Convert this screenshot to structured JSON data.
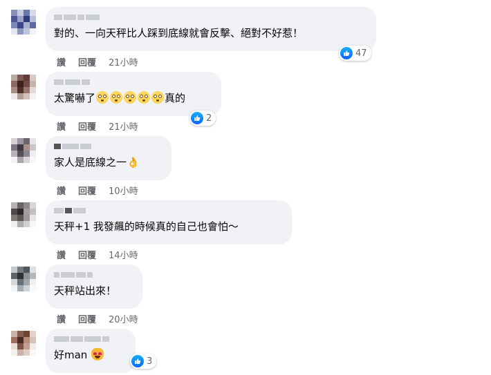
{
  "colors": {
    "bubble": "#f0f2f5",
    "meta": "#65676b",
    "like": "#0866ff"
  },
  "actions": {
    "like_label": "讚",
    "reply_label": "回覆"
  },
  "comments": [
    {
      "text": "對的、一向天秤比人踩到底線就會反擊、絕對不好惹！",
      "time": "21小時",
      "reactions": "47"
    },
    {
      "text_prefix": "太驚嚇了",
      "emoji": "flushed-face",
      "text_suffix": "真的",
      "time": "21小時",
      "reactions": "2"
    },
    {
      "text": "家人是底線之一",
      "emoji": "ok-hand",
      "time": "10小時"
    },
    {
      "text": "天秤+1 我發飆的時候真的自己也會怕～",
      "time": "14小時"
    },
    {
      "text": "天秤站出來！",
      "time": "20小時"
    },
    {
      "text": "好man",
      "emoji": "smiling-cat-heart-eyes",
      "reactions": "3"
    }
  ]
}
